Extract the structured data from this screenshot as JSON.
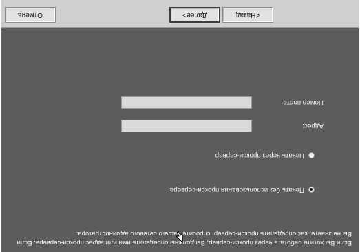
{
  "main": {
    "description": "Если Вы хотите работать через прокси-сервер, Вы должны определить имя или адрес прокси-сервера. Если Вы не знаете, как определить прокси-сервер, спросите вашего сетевого администратора.",
    "options": [
      {
        "label": "Печать без использования прокси-сервера",
        "selected": true
      },
      {
        "label": "Печать через прокси-сервер",
        "selected": false
      }
    ],
    "address": {
      "label": "Адрес:",
      "value": ""
    },
    "port": {
      "label": "Номер порта:",
      "value": ""
    }
  },
  "buttons": {
    "back": {
      "prefix": "< ",
      "mnemonic": "Н",
      "rest": "азад"
    },
    "next": {
      "mnemonic": "Д",
      "rest": "алее",
      "suffix": " >"
    },
    "cancel": "Отмена"
  },
  "cursor": {
    "icon": "mouse-pointer-icon"
  }
}
